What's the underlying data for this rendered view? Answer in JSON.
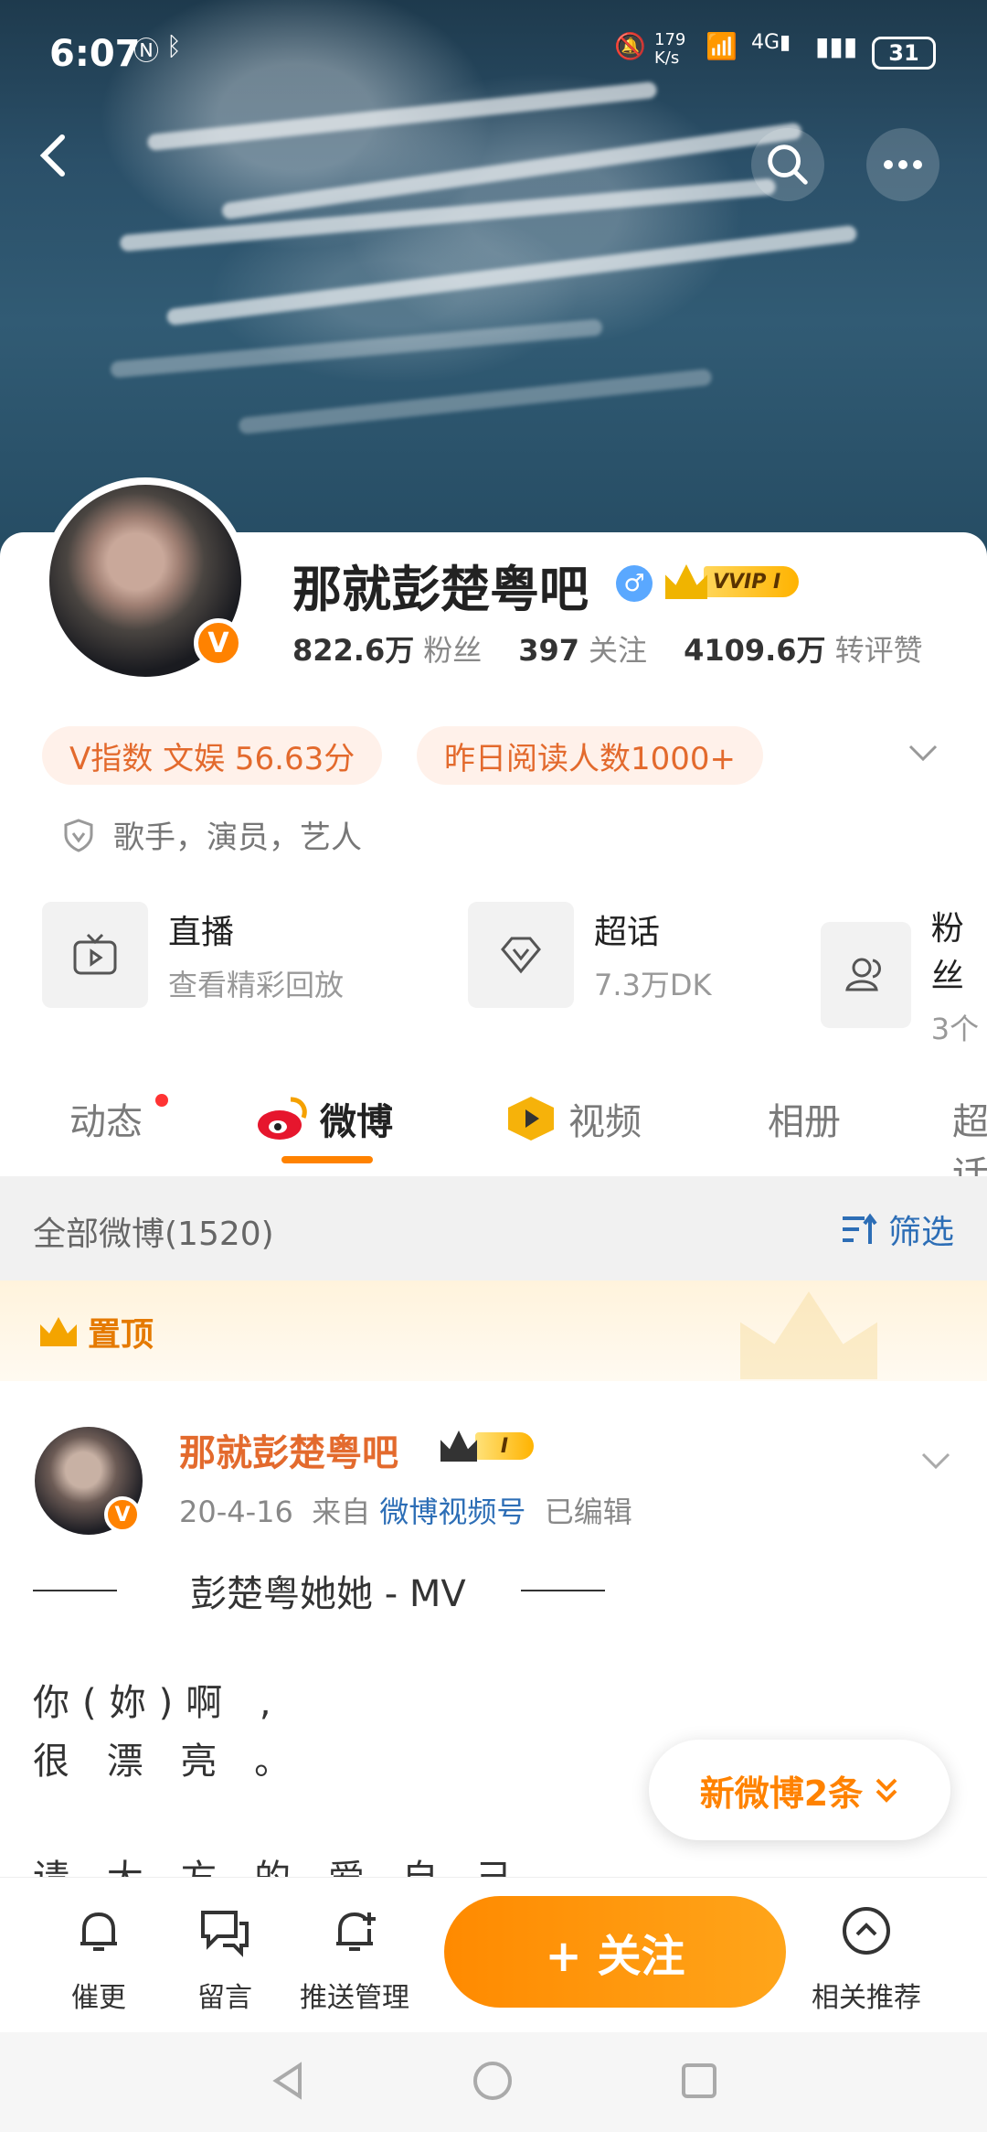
{
  "status_bar": {
    "time": "6:07",
    "net_speed": "179\nK/s",
    "battery": "31"
  },
  "profile": {
    "name": "那就彭楚粤吧",
    "vip_label": "VVIP I",
    "stats": [
      {
        "value": "822.6万",
        "label": "粉丝"
      },
      {
        "value": "397",
        "label": "关注"
      },
      {
        "value": "4109.6万",
        "label": "转评赞"
      }
    ],
    "chips": [
      "V指数 文娱 56.63分",
      "昨日阅读人数1000+"
    ],
    "tags_text": "歌手，演员，艺人",
    "services": [
      {
        "title": "直播",
        "subtitle": "查看精彩回放"
      },
      {
        "title": "超话",
        "subtitle": "7.3万DK"
      },
      {
        "title": "粉丝",
        "subtitle": "3个"
      }
    ]
  },
  "tabs": [
    "动态",
    "微博",
    "视频",
    "相册",
    "超话"
  ],
  "filter_bar": {
    "left": "全部微博(1520)",
    "right": "筛选"
  },
  "pinned_label": "置顶",
  "post": {
    "author": "那就彭楚粤吧",
    "vip_label": "I",
    "meta_date": "20-4-16",
    "meta_from": "来自",
    "meta_source": "微博视频号",
    "meta_edited": "已编辑",
    "title_text": "彭楚粤她她 - MV",
    "body_line1": "你(妳)啊 ,",
    "body_line2": "很 漂 亮 。",
    "body_line3": "请 大 方 的 爱 自 己"
  },
  "new_posts": "新微博2条",
  "bottom_bar": {
    "items": [
      "催更",
      "留言",
      "推送管理",
      "相关推荐"
    ],
    "follow_label": "+ 关注"
  }
}
